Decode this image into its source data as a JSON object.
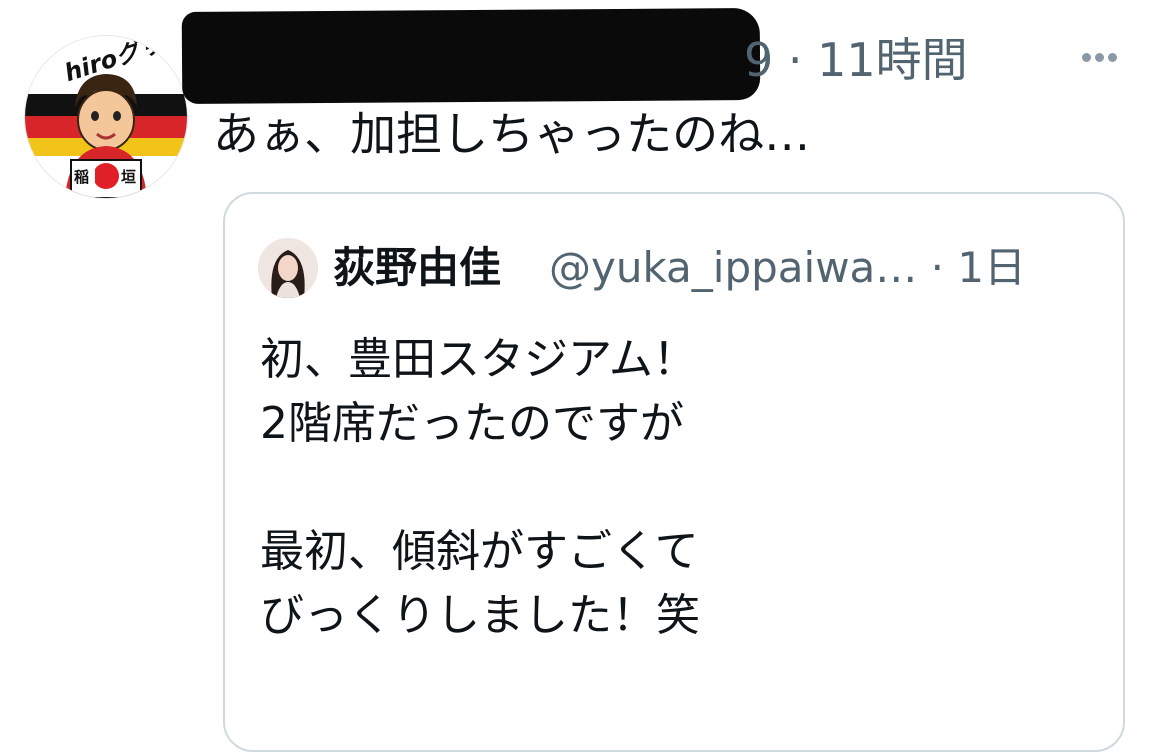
{
  "tweet": {
    "time_suffix": "9 · 11時間",
    "text": "あぁ、加担しちゃったのね…",
    "avatar": {
      "top_text": "hiroグリ",
      "left_kanji": "稲",
      "right_kanji": "垣"
    },
    "more_icon": "more-horizontal-icon"
  },
  "quote": {
    "name": "荻野由佳",
    "handle_time": "@yuka_ippaiwa… · 1日",
    "lines": [
      "初、豊田スタジアム！",
      "2階席だったのですが",
      "",
      "最初、傾斜がすごくて",
      "びっくりしました！笑"
    ]
  },
  "colors": {
    "text_primary": "#0f1419",
    "text_secondary": "#536471",
    "card_border": "#cfd9de",
    "redaction": "#0a0a0a"
  }
}
